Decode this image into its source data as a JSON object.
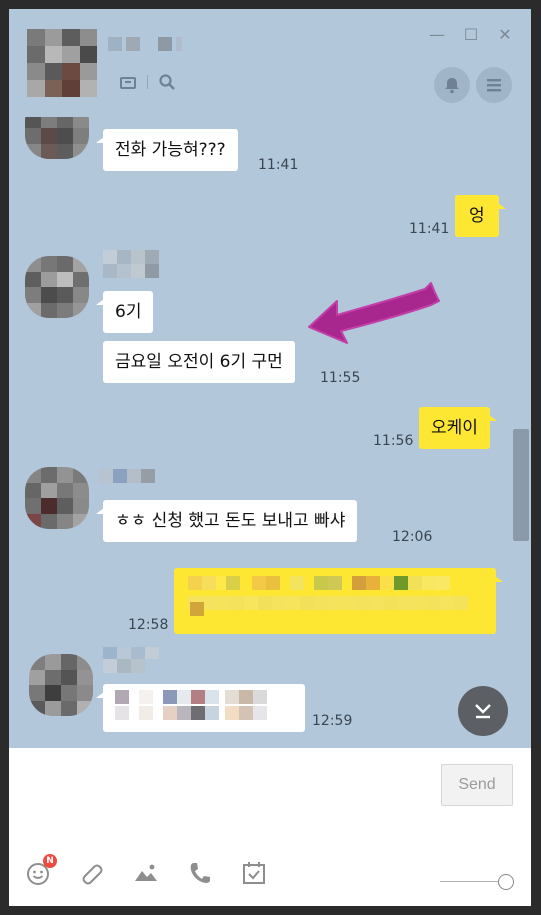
{
  "window": {
    "controls": {
      "minimize": "—",
      "maximize": "☐",
      "close": "✕"
    }
  },
  "header": {
    "icons": [
      "inbox-icon",
      "search-icon",
      "bell-icon",
      "menu-icon"
    ]
  },
  "messages": [
    {
      "id": "m1",
      "side": "in",
      "text": "전화 가능혀???",
      "time": "11:41"
    },
    {
      "id": "m2",
      "side": "out",
      "text": "엉",
      "time": "11:41"
    },
    {
      "id": "m3",
      "side": "in",
      "text": "6기",
      "time": ""
    },
    {
      "id": "m4",
      "side": "in",
      "text": "금요일 오전이 6기 구먼",
      "time": "11:55"
    },
    {
      "id": "m5",
      "side": "out",
      "text": "오케이",
      "time": "11:56"
    },
    {
      "id": "m6",
      "side": "in",
      "text": "ㅎㅎ 신청 했고 돈도 보내고 빠샤",
      "time": "12:06"
    },
    {
      "id": "m7",
      "side": "out",
      "text": "",
      "time": "12:58",
      "redacted": true
    },
    {
      "id": "m8",
      "side": "in",
      "text": "",
      "time": "12:59",
      "redacted": true
    }
  ],
  "annotation": {
    "type": "arrow",
    "color": "#a8278f"
  },
  "input": {
    "send_label": "Send",
    "placeholder": ""
  },
  "toolbar": {
    "emoticon_badge": "N",
    "icons": [
      "emoticon-icon",
      "attach-icon",
      "image-icon",
      "call-icon",
      "schedule-icon"
    ]
  },
  "colors": {
    "chat_bg": "#b2c7da",
    "bubble_in": "#ffffff",
    "bubble_out": "#fee733",
    "badge": "#f04a40"
  }
}
